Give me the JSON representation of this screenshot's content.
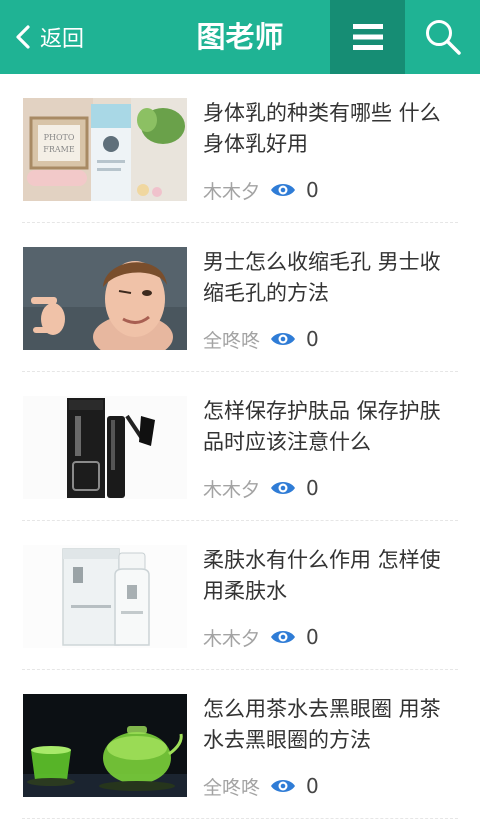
{
  "header": {
    "back_label": "返回",
    "title": "图老师",
    "accent_color": "#1fb394",
    "menu_icon": "hamburger-icon",
    "search_icon": "search-icon"
  },
  "articles": [
    {
      "title": "身体乳的种类有哪些 什么身体乳好用",
      "author": "木木夕",
      "views": "0",
      "thumbnail": "body-lotion-photo"
    },
    {
      "title": "男士怎么收缩毛孔 男士收缩毛孔的方法",
      "author": "全咚咚",
      "views": "0",
      "thumbnail": "man-winking-photo"
    },
    {
      "title": "怎样保存护肤品 保存护肤品时应该注意什么",
      "author": "木木夕",
      "views": "0",
      "thumbnail": "mascara-photo"
    },
    {
      "title": "柔肤水有什么作用 怎样使用柔肤水",
      "author": "木木夕",
      "views": "0",
      "thumbnail": "toner-bottle-photo"
    },
    {
      "title": "怎么用茶水去黑眼圈 用茶水去黑眼圈的方法",
      "author": "全咚咚",
      "views": "0",
      "thumbnail": "green-tea-photo"
    }
  ]
}
